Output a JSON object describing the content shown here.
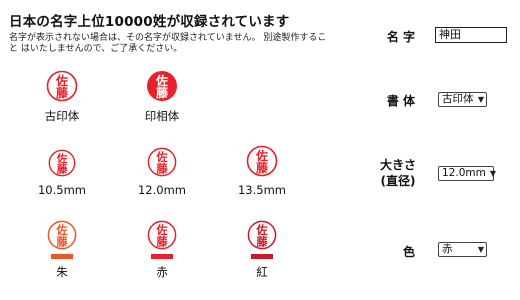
{
  "header": {
    "title": "日本の名字上位10000姓が収録されています",
    "note": "名字が表示されない場合は、その名字が収録されていません。 別途製作すること はいたしませんので、ご了承ください。"
  },
  "seal_glyph_top": "佐",
  "seal_glyph_bottom": "藤",
  "styles": [
    {
      "label": "古印体"
    },
    {
      "label": "印相体"
    }
  ],
  "sizes": [
    {
      "label": "10.5mm"
    },
    {
      "label": "12.0mm"
    },
    {
      "label": "13.5mm"
    }
  ],
  "colors": [
    {
      "label": "朱",
      "color": "#f0552a"
    },
    {
      "label": "赤",
      "color": "#e8212a"
    },
    {
      "label": "紅",
      "color": "#c81b2a"
    }
  ],
  "form": {
    "name_label": "名 字",
    "name_value": "神田",
    "font_label": "書 体",
    "font_value": "古印体",
    "size_label_line1": "大きさ",
    "size_label_line2": "(直径)",
    "size_value": "12.0mm",
    "color_label": "色",
    "color_value": "赤"
  }
}
